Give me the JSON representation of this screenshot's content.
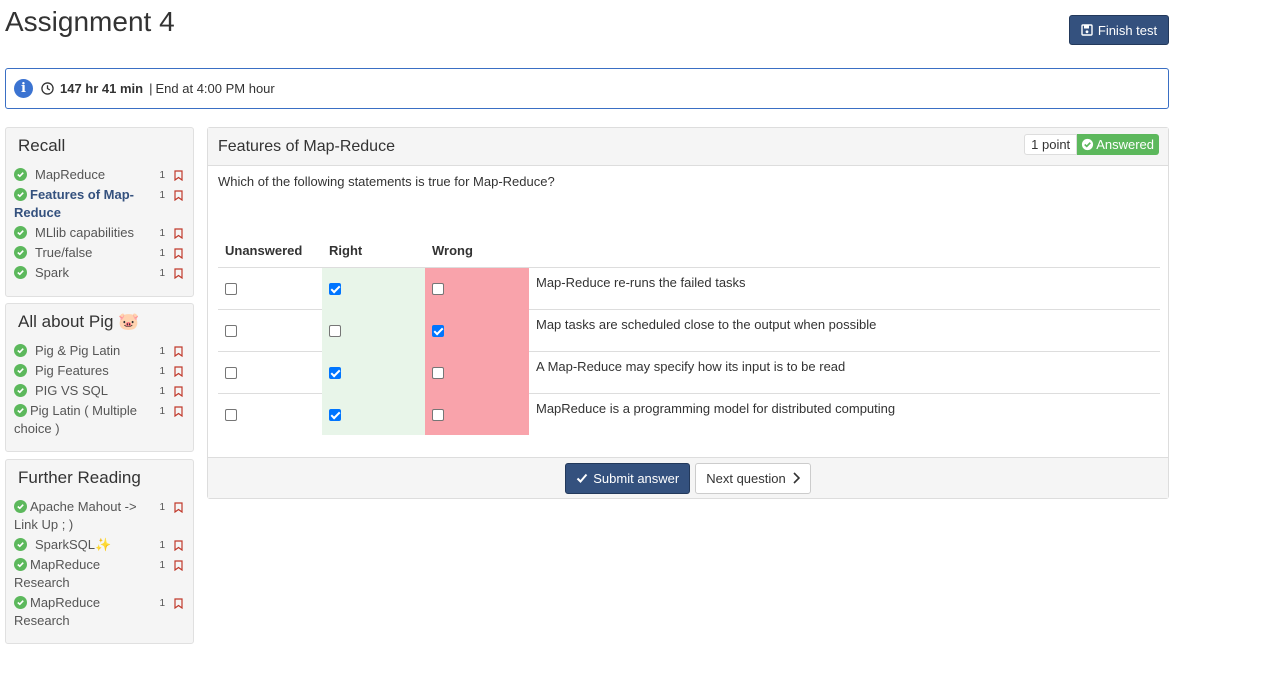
{
  "header": {
    "title": "Assignment 4",
    "finish_label": "Finish test"
  },
  "timer": {
    "remaining": "147 hr 41 min",
    "separator": "|",
    "end_text": "End at 4:00 PM hour"
  },
  "sidebar": {
    "sections": [
      {
        "title": "Recall",
        "items": [
          {
            "label": "MapReduce",
            "points": "1"
          },
          {
            "label": "Features of Map-Reduce",
            "points": "1"
          },
          {
            "label": "MLlib capabilities",
            "points": "1"
          },
          {
            "label": "True/false",
            "points": "1"
          },
          {
            "label": "Spark",
            "points": "1"
          }
        ]
      },
      {
        "title": "All about Pig 🐷",
        "items": [
          {
            "label": "Pig & Pig Latin",
            "points": "1"
          },
          {
            "label": "Pig Features",
            "points": "1"
          },
          {
            "label": "PIG VS SQL",
            "points": "1"
          },
          {
            "label": "Pig Latin ( Multiple choice )",
            "points": "1"
          }
        ]
      },
      {
        "title": "Further Reading",
        "items": [
          {
            "label": "Apache Mahout -> Link Up ; )",
            "points": "1"
          },
          {
            "label": "SparkSQL✨",
            "points": "1"
          },
          {
            "label": "MapReduce Research",
            "points": "1"
          },
          {
            "label": "MapReduce Research",
            "points": "1"
          }
        ]
      }
    ]
  },
  "question": {
    "title": "Features of Map-Reduce",
    "points_badge": "1 point",
    "status_badge": "Answered",
    "text": "Which of the following statements is true for Map-Reduce?",
    "columns": [
      "Unanswered",
      "Right",
      "Wrong"
    ],
    "rows": [
      {
        "statement": "Map-Reduce re-runs the failed tasks",
        "unanswered": false,
        "right": true,
        "wrong": false
      },
      {
        "statement": "Map tasks are scheduled close to the output when possible",
        "unanswered": false,
        "right": false,
        "wrong": true
      },
      {
        "statement": "A Map-Reduce may specify how its input is to be read",
        "unanswered": false,
        "right": true,
        "wrong": false
      },
      {
        "statement": "MapReduce is a programming model for distributed computing",
        "unanswered": false,
        "right": true,
        "wrong": false
      }
    ],
    "submit_label": "Submit answer",
    "next_label": "Next question"
  },
  "colors": {
    "primary": "#34517e",
    "success": "#5cb85c",
    "right_bg": "#e8f5e9",
    "wrong_bg": "#f9a3ab",
    "info": "#3b73d1"
  }
}
